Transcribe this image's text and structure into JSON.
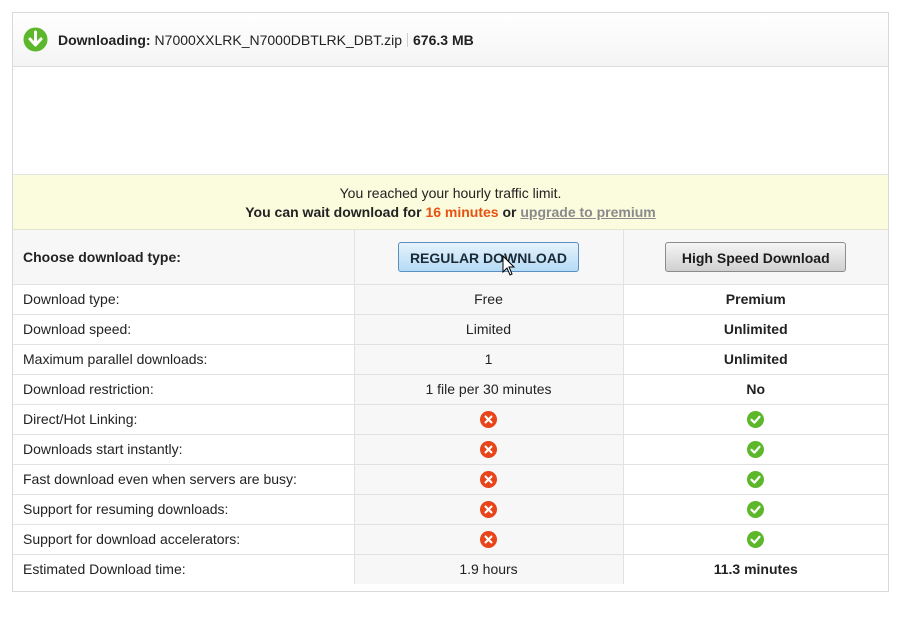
{
  "header": {
    "label": "Downloading:",
    "filename": "N7000XXLRK_N7000DBTLRK_DBT.zip",
    "filesize": "676.3 MB",
    "icon": "download-arrow-icon"
  },
  "notice": {
    "line1": "You reached your hourly traffic limit.",
    "line2_prefix": "You can wait download for",
    "wait_time": "16 minutes",
    "line2_mid": "or",
    "upgrade_link": "upgrade to premium"
  },
  "colors": {
    "wait_time": "#e8500f",
    "check": "#5cb82a",
    "cross": "#e8451a",
    "notice_bg": "#fbfbde"
  },
  "table": {
    "choose_label": "Choose download type:",
    "regular_button": "REGULAR DOWNLOAD",
    "premium_button": "High Speed Download",
    "rows": [
      {
        "label": "Download type:",
        "free": "Free",
        "premium": "Premium"
      },
      {
        "label": "Download speed:",
        "free": "Limited",
        "premium": "Unlimited"
      },
      {
        "label": "Maximum parallel downloads:",
        "free": "1",
        "premium": "Unlimited"
      },
      {
        "label": "Download restriction:",
        "free": "1 file per 30 minutes",
        "premium": "No"
      },
      {
        "label": "Direct/Hot Linking:",
        "free_icon": "cross-icon",
        "premium_icon": "check-icon"
      },
      {
        "label": "Downloads start instantly:",
        "free_icon": "cross-icon",
        "premium_icon": "check-icon"
      },
      {
        "label": "Fast download even when servers are busy:",
        "free_icon": "cross-icon",
        "premium_icon": "check-icon"
      },
      {
        "label": "Support for resuming downloads:",
        "free_icon": "cross-icon",
        "premium_icon": "check-icon"
      },
      {
        "label": "Support for download accelerators:",
        "free_icon": "cross-icon",
        "premium_icon": "check-icon"
      },
      {
        "label": "Estimated Download time:",
        "free": "1.9 hours",
        "premium": "11.3 minutes"
      }
    ]
  }
}
